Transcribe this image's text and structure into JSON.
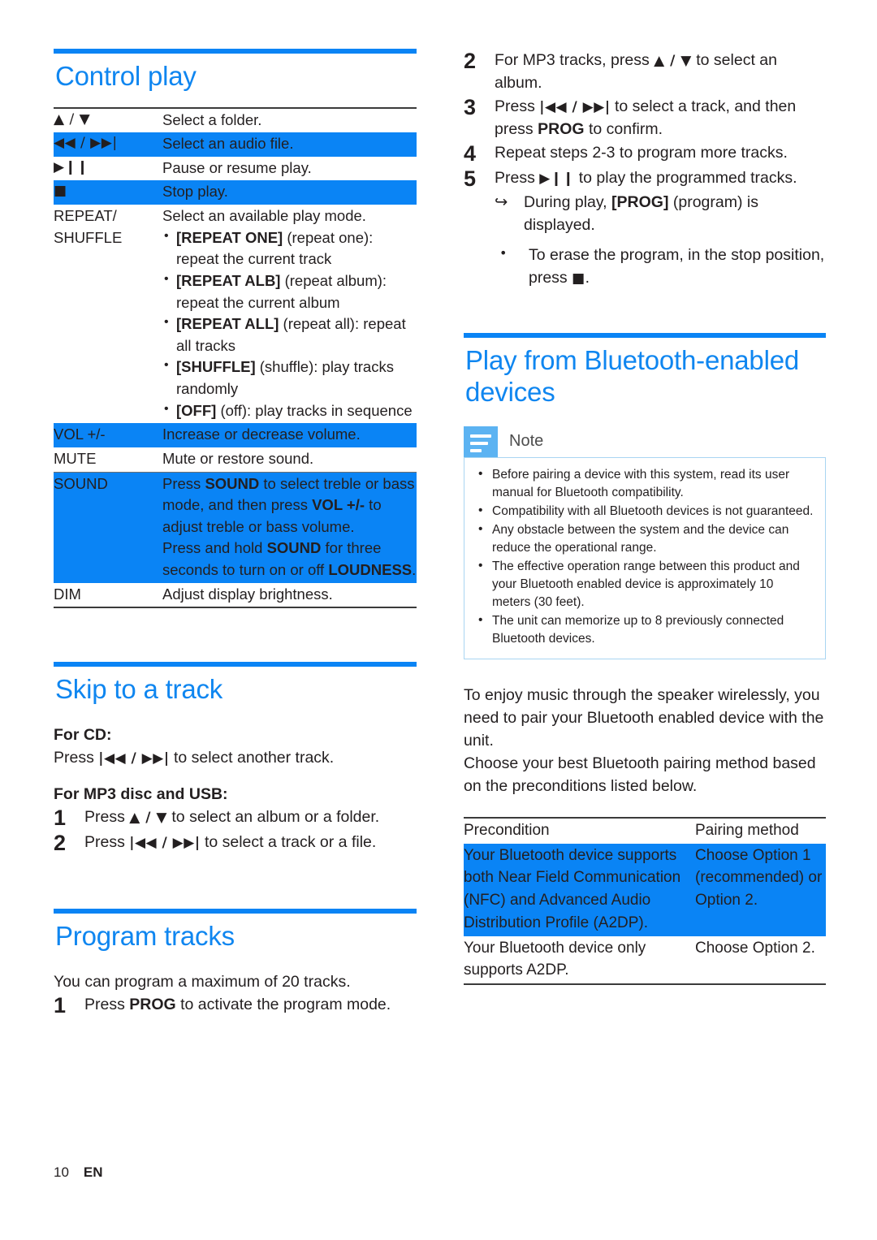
{
  "colors": {
    "accent": "#0f86f0",
    "highlight": "#0a84f5",
    "note_icon": "#5cb3f2",
    "note_border": "#a9d5f2"
  },
  "footer": {
    "page_number": "10",
    "language": "EN"
  },
  "left_column": {
    "control_play": {
      "heading": "Control play",
      "rows": [
        {
          "key": "▲ / ▼",
          "key_is_glyph": true,
          "highlight": false,
          "lines": [
            "Select a folder."
          ]
        },
        {
          "key": "◀◀ / ▶▶|",
          "key_is_glyph": true,
          "highlight": true,
          "lines": [
            "Select an audio file."
          ]
        },
        {
          "key": "▶❙❙",
          "key_is_glyph": true,
          "highlight": false,
          "lines": [
            "Pause or resume play."
          ]
        },
        {
          "key": "■",
          "key_is_glyph": true,
          "highlight": true,
          "lines": [
            "Stop play."
          ]
        },
        {
          "key": "REPEAT/ SHUFFLE",
          "key_is_glyph": false,
          "highlight": false,
          "lines": [
            "Select an available play mode."
          ],
          "bullets": [
            {
              "bold": "[REPEAT ONE]",
              "rest": " (repeat one): repeat the current track"
            },
            {
              "bold": "[REPEAT ALB]",
              "rest": " (repeat album): repeat the current album"
            },
            {
              "bold": "[REPEAT ALL]",
              "rest": " (repeat all): repeat all tracks"
            },
            {
              "bold": "[SHUFFLE]",
              "rest": " (shuffle): play tracks randomly"
            },
            {
              "bold": "[OFF]",
              "rest": " (off): play tracks in sequence"
            }
          ]
        },
        {
          "key": "VOL +/-",
          "key_is_glyph": false,
          "highlight": true,
          "lines": [
            "Increase or decrease volume."
          ]
        },
        {
          "key": "MUTE",
          "key_is_glyph": false,
          "highlight": false,
          "lines": [
            "Mute or restore sound."
          ]
        },
        {
          "key": "SOUND",
          "key_is_glyph": false,
          "highlight": true,
          "lines": [
            "Press SOUND to select treble or bass mode, and then press VOL +/- to adjust treble or bass volume.",
            "Press and hold SOUND for three seconds to turn on or off LOUDNESS."
          ]
        },
        {
          "key": "DIM",
          "key_is_glyph": false,
          "highlight": false,
          "lines": [
            "Adjust display brightness."
          ]
        }
      ],
      "key_labels": {
        "repeat_shuffle_line1": "REPEAT/",
        "repeat_shuffle_line2": "SHUFFLE",
        "vol": "VOL +/-",
        "mute": "MUTE",
        "sound": "SOUND",
        "dim": "DIM"
      },
      "row_text": {
        "select_folder": "Select a folder.",
        "select_audio_file": "Select an audio file.",
        "pause_resume": "Pause or resume play.",
        "stop_play": "Stop play.",
        "select_play_mode": "Select an available play mode.",
        "increase_decrease": "Increase or decrease volume.",
        "mute_restore": "Mute or restore sound.",
        "adjust_brightness": "Adjust display brightness."
      },
      "sound_text": {
        "p1_a": "Press ",
        "p1_b": "SOUND",
        "p1_c": " to select treble or bass mode, and then press ",
        "p1_d": "VOL +/-",
        "p1_e": " to adjust treble or bass volume.",
        "p2_a": "Press and hold ",
        "p2_b": "SOUND",
        "p2_c": " for three seconds to turn on or off ",
        "p2_d": "LOUDNESS",
        "p2_e": "."
      }
    },
    "skip_to_track": {
      "heading": "Skip to a track",
      "for_cd_label": "For CD:",
      "for_cd_text_a": "Press ",
      "for_cd_glyph": "|◀◀ / ▶▶|",
      "for_cd_text_b": " to select another track.",
      "for_mp3_label": "For MP3 disc and USB:",
      "steps": [
        {
          "num": "1",
          "a": "Press ",
          "glyph": "▲ / ▼",
          "b": " to select an album or a folder."
        },
        {
          "num": "2",
          "a": "Press ",
          "glyph": "|◀◀ / ▶▶|",
          "b": " to select a track or a file."
        }
      ]
    },
    "program_tracks": {
      "heading": "Program tracks",
      "intro": "You can program a maximum of 20 tracks.",
      "step1_num": "1",
      "step1_a": "Press ",
      "step1_b": "PROG",
      "step1_c": " to activate the program mode."
    }
  },
  "right_column": {
    "program_steps": [
      {
        "num": "2",
        "a": "For MP3 tracks, press ",
        "glyph": "▲ / ▼",
        "b": " to select an album."
      },
      {
        "num": "3",
        "a": "Press ",
        "glyph": "|◀◀ / ▶▶|",
        "b": " to select a track, and then press ",
        "bold": "PROG",
        "c": " to confirm."
      },
      {
        "num": "4",
        "a": "Repeat steps 2-3 to program more tracks."
      },
      {
        "num": "5",
        "a": "Press ",
        "glyph": "▶❙❙",
        "b": " to play the programmed tracks."
      }
    ],
    "sub_notes": [
      {
        "marker": "arrow",
        "a": "During play, ",
        "bold": "[PROG]",
        "b": " (program) is displayed."
      },
      {
        "marker": "dot",
        "a": "To erase the program, in the stop position, press ",
        "glyph": "■",
        "b": "."
      }
    ],
    "bluetooth": {
      "heading": "Play from Bluetooth-enabled devices",
      "note_label": "Note",
      "note_items": [
        "Before pairing a device with this system, read its user manual for Bluetooth compatibility.",
        "Compatibility with all Bluetooth devices is not guaranteed.",
        "Any obstacle between the system and the device can reduce the operational range.",
        "The effective operation range between this product and your Bluetooth enabled device is approximately 10 meters (30 feet).",
        "The unit can memorize up to 8 previously connected Bluetooth devices."
      ],
      "paragraphs": [
        "To enjoy music through the speaker wirelessly, you need to pair your Bluetooth enabled device with the unit.",
        "Choose your best Bluetooth pairing method based on the preconditions listed below."
      ],
      "table": {
        "headers": [
          "Precondition",
          "Pairing method"
        ],
        "rows": [
          {
            "highlight": true,
            "precondition": "Your Bluetooth device supports both Near Field Communication (NFC) and Advanced Audio Distribution Profile (A2DP).",
            "pairing_method": "Choose Option 1 (recommended) or Option 2."
          },
          {
            "highlight": false,
            "precondition": "Your Bluetooth device only supports A2DP.",
            "pairing_method": "Choose Option 2."
          }
        ]
      }
    }
  }
}
